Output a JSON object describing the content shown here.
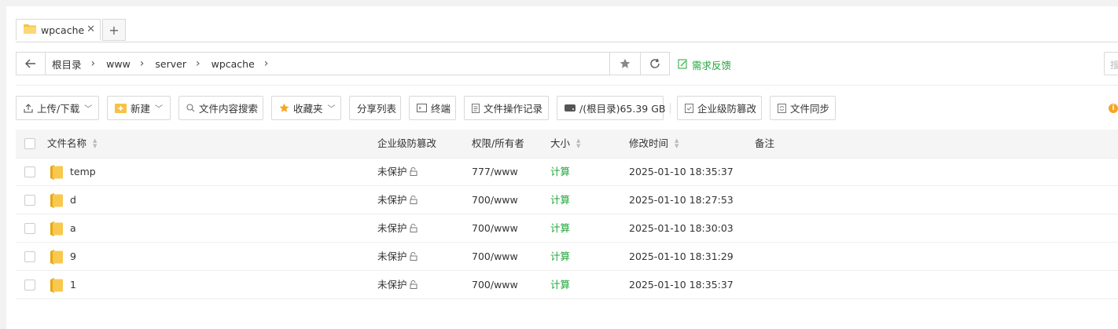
{
  "tabs": [
    {
      "label": "wpcache",
      "close": "✕"
    }
  ],
  "tab_add": "+",
  "breadcrumbs": [
    "根目录",
    "www",
    "server",
    "wpcache"
  ],
  "breadcrumb_sep": "›",
  "feedback_label": "需求反馈",
  "search_hint": "搜",
  "toolbar": {
    "upload": "上传/下载",
    "new": "新建",
    "content_search": "文件内容搜索",
    "favorites": "收藏夹",
    "share_list": "分享列表",
    "terminal": "终端",
    "op_log": "文件操作记录",
    "disk": "/(根目录)65.39 GB",
    "tamper": "企业级防篡改",
    "sync": "文件同步"
  },
  "columns": {
    "name": "文件名称",
    "tamper": "企业级防篡改",
    "perm": "权限/所有者",
    "size": "大小",
    "mtime": "修改时间",
    "note": "备注"
  },
  "rows": [
    {
      "name": "temp",
      "tamper": "未保护",
      "perm": "777/www",
      "size": "计算",
      "mtime": "2025-01-10 18:35:37",
      "note": ""
    },
    {
      "name": "d",
      "tamper": "未保护",
      "perm": "700/www",
      "size": "计算",
      "mtime": "2025-01-10 18:27:53",
      "note": ""
    },
    {
      "name": "a",
      "tamper": "未保护",
      "perm": "700/www",
      "size": "计算",
      "mtime": "2025-01-10 18:30:03",
      "note": ""
    },
    {
      "name": "9",
      "tamper": "未保护",
      "perm": "700/www",
      "size": "计算",
      "mtime": "2025-01-10 18:31:29",
      "note": ""
    },
    {
      "name": "1",
      "tamper": "未保护",
      "perm": "700/www",
      "size": "计算",
      "mtime": "2025-01-10 18:35:37",
      "note": ""
    }
  ],
  "colors": {
    "accent": "#20a53a",
    "folder": "#f6c343",
    "warning": "#f5a623"
  },
  "icons": [
    "folder-icon",
    "close-icon",
    "plus-icon",
    "back-arrow-icon",
    "chevron-right-icon",
    "star-icon",
    "refresh-icon",
    "edit-icon",
    "upload-icon",
    "new-folder-icon",
    "search-icon",
    "terminal-icon",
    "document-icon",
    "disk-icon",
    "shield-icon",
    "sync-icon",
    "info-icon",
    "lock-icon",
    "sort-icon"
  ]
}
